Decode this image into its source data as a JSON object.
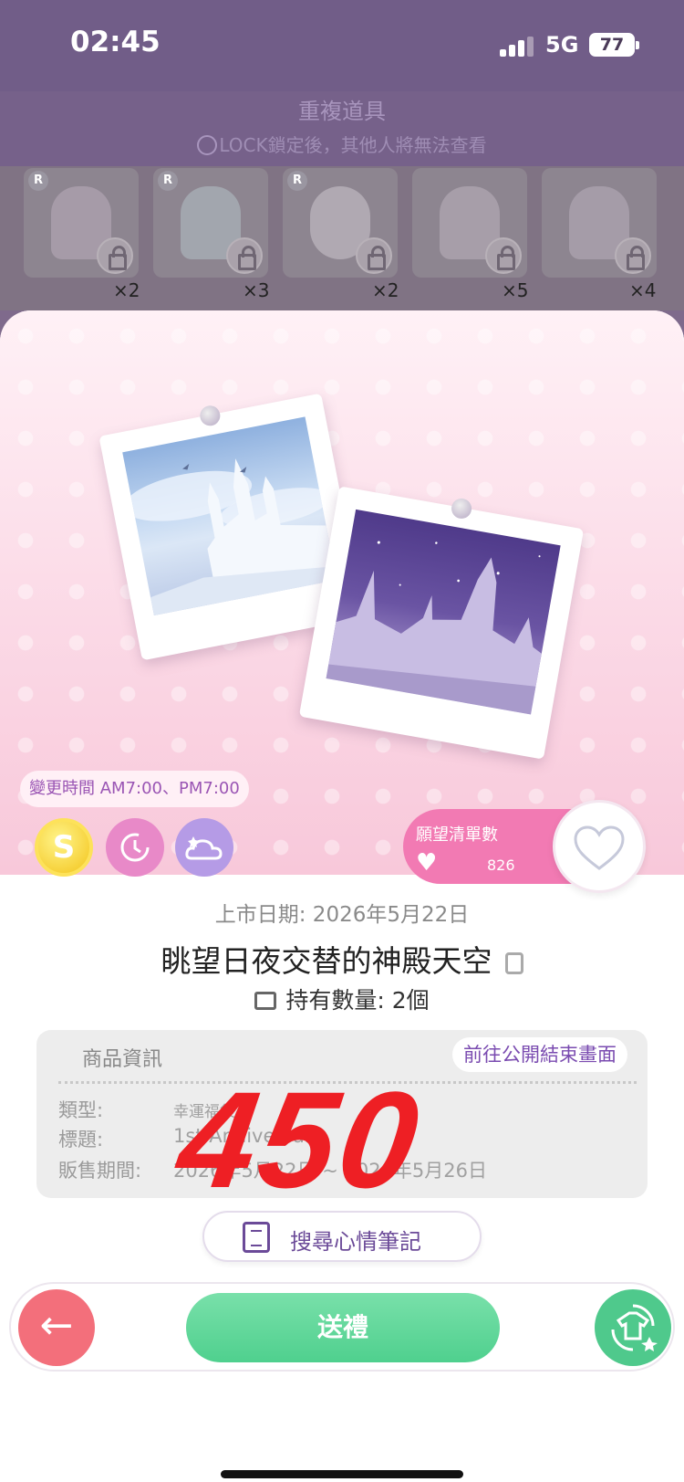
{
  "status": {
    "time": "02:45",
    "network": "5G",
    "battery": "77"
  },
  "header": {
    "title": "重複道具",
    "subtitle": "LOCK鎖定後，其他人將無法查看"
  },
  "items": [
    {
      "rarity": "R",
      "qty": "×2"
    },
    {
      "rarity": "R",
      "qty": "×3"
    },
    {
      "rarity": "R",
      "qty": "×2"
    },
    {
      "rarity": "",
      "qty": "×5"
    },
    {
      "rarity": "",
      "qty": "×4"
    }
  ],
  "detail": {
    "change_time": "變更時間 AM7:00、PM7:00",
    "badge_s": "S",
    "wishlist": {
      "label": "願望清單數",
      "count": "826"
    },
    "release_date": "上市日期: 2026年5月22日",
    "name": "眺望日夜交替的神殿天空",
    "owned": "持有數量: 2個",
    "info": {
      "title": "商品資訊",
      "goto_button": "前往公開結束畫面",
      "type_label": "類型:",
      "type_value": "幸運福袋",
      "tag_label": "標題:",
      "tag_value": "1st Anniversary",
      "period_label": "販售期間:",
      "period_value": "2026年5月22日 ~ 2026年5月26日"
    },
    "price_stamp": "450",
    "diary_button": "搜尋心情筆記"
  },
  "actions": {
    "gift": "送禮"
  },
  "colors": {
    "accent_pink": "#f27ab3",
    "gift_green": "#4fd08e",
    "back_red": "#f36f7b",
    "price_red": "#ee1f24",
    "purple_text": "#6b4a98"
  },
  "icons": [
    "signal-icon",
    "battery-icon",
    "lock-icon",
    "clock-icon",
    "cloud-icon",
    "heart-icon",
    "copy-icon",
    "bag-icon",
    "notebook-icon",
    "back-arrow-icon",
    "swap-icon"
  ]
}
